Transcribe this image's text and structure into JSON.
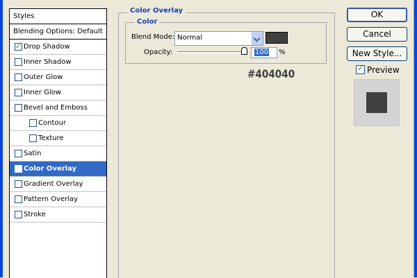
{
  "styles_panel": {
    "header": "Styles",
    "blending_options": "Blending Options: Default",
    "items": [
      {
        "label": "Drop Shadow",
        "checked": true,
        "indent": 0,
        "selected": false
      },
      {
        "label": "Inner Shadow",
        "checked": false,
        "indent": 0,
        "selected": false
      },
      {
        "label": "Outer Glow",
        "checked": false,
        "indent": 0,
        "selected": false
      },
      {
        "label": "Inner Glow",
        "checked": false,
        "indent": 0,
        "selected": false
      },
      {
        "label": "Bevel and Emboss",
        "checked": false,
        "indent": 0,
        "selected": false
      },
      {
        "label": "Contour",
        "checked": false,
        "indent": 1,
        "selected": false
      },
      {
        "label": "Texture",
        "checked": false,
        "indent": 1,
        "selected": false
      },
      {
        "label": "Satin",
        "checked": false,
        "indent": 0,
        "selected": false
      },
      {
        "label": "Color Overlay",
        "checked": true,
        "indent": 0,
        "selected": true
      },
      {
        "label": "Gradient Overlay",
        "checked": false,
        "indent": 0,
        "selected": false
      },
      {
        "label": "Pattern Overlay",
        "checked": false,
        "indent": 0,
        "selected": false
      },
      {
        "label": "Stroke",
        "checked": false,
        "indent": 0,
        "selected": false
      }
    ]
  },
  "color_overlay": {
    "section_title": "Color Overlay",
    "group_title": "Color",
    "blend_mode_label": "Blend Mode:",
    "blend_mode_value": "Normal",
    "overlay_color": "#404040",
    "opacity_label": "Opacity:",
    "opacity_value": "100",
    "opacity_unit": "%",
    "hex_note": "#404040"
  },
  "buttons": {
    "ok": "OK",
    "cancel": "Cancel",
    "new_style": "New Style..."
  },
  "preview": {
    "label": "Preview",
    "checked": true,
    "swatch_color": "#404040"
  },
  "colors": {
    "selection": "#316ac5",
    "section_title": "#1a3fb5",
    "window_frame": "#0a46d8"
  }
}
